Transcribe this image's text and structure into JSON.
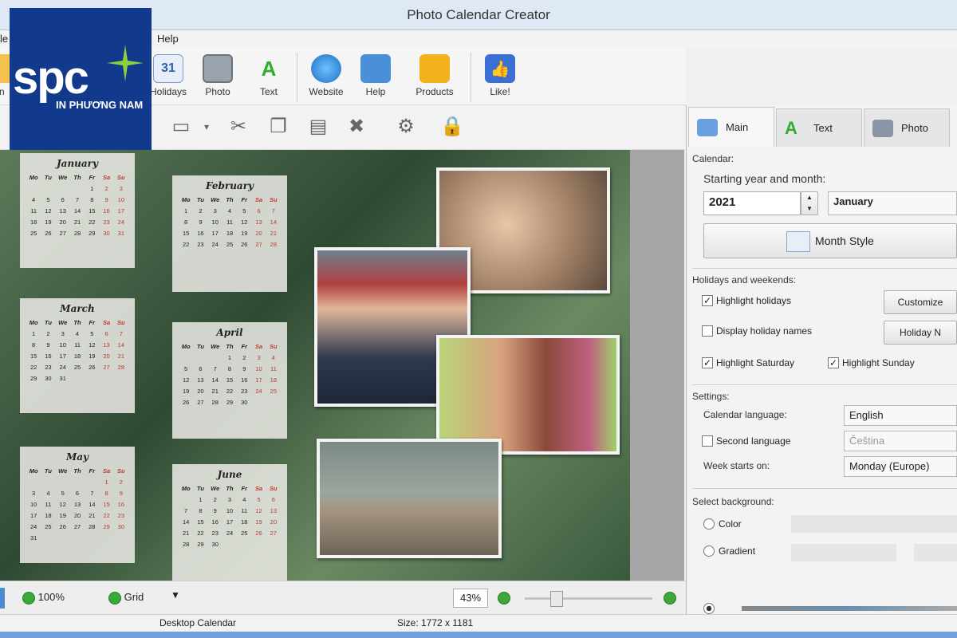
{
  "window": {
    "title": "Photo Calendar Creator"
  },
  "menu": {
    "file_fragment": "le",
    "help": "Help"
  },
  "toolbar": {
    "buttons": [
      {
        "label": "en",
        "icon": "open-icon"
      },
      {
        "label": "Holidays",
        "icon": "calendar-icon"
      },
      {
        "label": "Photo",
        "icon": "camera-icon"
      },
      {
        "label": "Text",
        "icon": "letter-a-icon"
      },
      {
        "label": "Website",
        "icon": "globe-icon"
      },
      {
        "label": "Help",
        "icon": "book-icon"
      },
      {
        "label": "Products",
        "icon": "box-icon"
      },
      {
        "label": "Like!",
        "icon": "thumbs-up-icon"
      }
    ]
  },
  "logo": {
    "brand": "spc",
    "tagline": "IN PHƯƠNG NAM"
  },
  "calendars": [
    {
      "month": "January",
      "weekdays": [
        "Mo",
        "Tu",
        "We",
        "Th",
        "Fr",
        "Sa",
        "Su"
      ]
    },
    {
      "month": "February"
    },
    {
      "month": "March"
    },
    {
      "month": "April"
    },
    {
      "month": "May"
    },
    {
      "month": "June"
    }
  ],
  "panel": {
    "tabs": [
      "Main",
      "Text",
      "Photo"
    ],
    "calendar_group": "Calendar:",
    "start_label": "Starting year and month:",
    "year": "2021",
    "month": "January",
    "month_style_button": "Month Style",
    "holidays_group": "Holidays and weekends:",
    "highlight_holidays": "Highlight holidays",
    "customize_button": "Customize",
    "display_holiday_names": "Display holiday names",
    "holiday_names_button": "Holiday N",
    "highlight_saturday": "Highlight Saturday",
    "highlight_sunday": "Highlight Sunday",
    "settings_group": "Settings:",
    "calendar_language_label": "Calendar language:",
    "calendar_language": "English",
    "second_language_label": "Second language",
    "second_language": "Čeština",
    "week_starts_label": "Week starts on:",
    "week_starts": "Monday (Europe)",
    "background_group": "Select background:",
    "color_option": "Color",
    "gradient_option": "Gradient"
  },
  "statusbar": {
    "zoom_reset": "100%",
    "grid": "Grid",
    "zoom_value": "43%"
  },
  "bottom": {
    "project": "Desktop Calendar",
    "size": "Size: 1772 x 1181"
  },
  "colors": {
    "weekend": "#c0392b",
    "logo_bg": "#123a8c",
    "accent": "#3aa93a"
  }
}
